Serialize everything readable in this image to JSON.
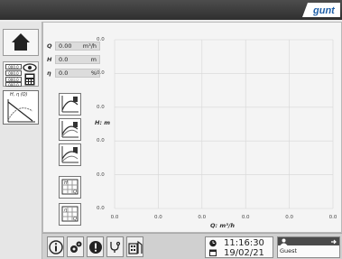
{
  "app": {
    "logo_text": "gunt"
  },
  "colors": {
    "topbar": "#3c3c3c",
    "logo_bg": "#ffffff",
    "logo_text": "#1f5fa6",
    "grid": "#d6d6d6"
  },
  "nav": {
    "mini_values": [
      "000.0",
      "000.0",
      "000.0",
      "000.0"
    ],
    "chart_button_label": "H, η (Q)"
  },
  "measurements": [
    {
      "symbol": "Q",
      "value": "0.00",
      "unit": "m³/h"
    },
    {
      "symbol": "H",
      "value": "0.0",
      "unit": "m"
    },
    {
      "symbol": "η",
      "value": "0.0",
      "unit": "%"
    }
  ],
  "chart_data": {
    "type": "line",
    "xlabel": "Q: m³/h",
    "ylabel": "H: m",
    "x_ticks": [
      "0.0",
      "0.0",
      "0.0",
      "0.0",
      "0.0",
      "0.0"
    ],
    "y_ticks": [
      "0.0",
      "0.0",
      "0.0",
      "0.0",
      "0.0",
      "0.0"
    ],
    "grid": true,
    "series": []
  },
  "footer": {
    "time": "11:16:30",
    "date": "19/02/21",
    "user": "Guest"
  }
}
